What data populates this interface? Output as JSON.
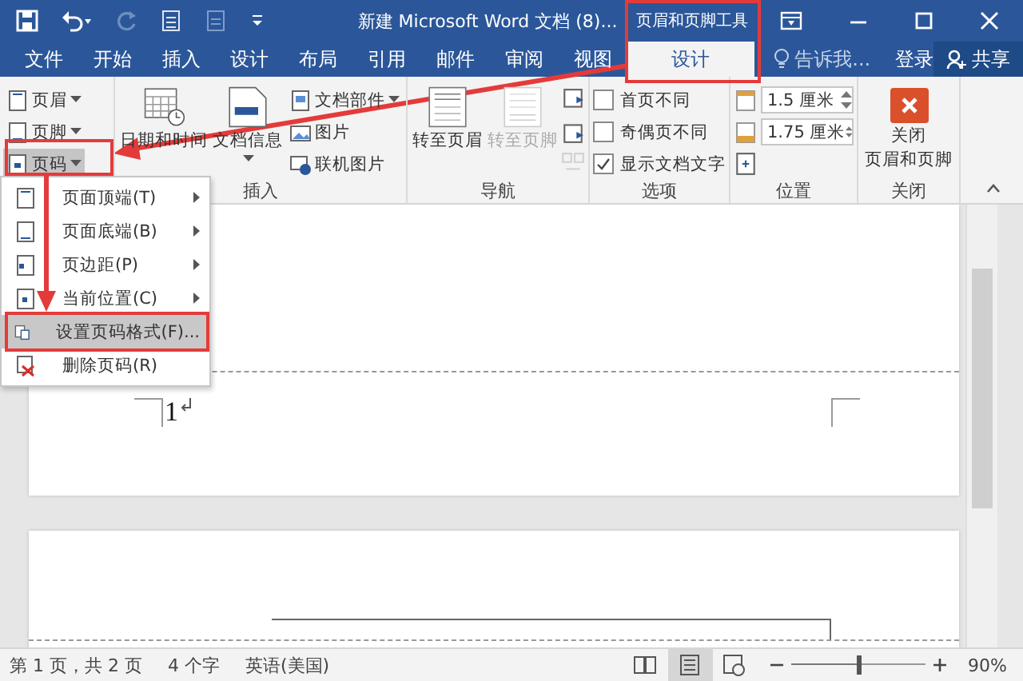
{
  "title_bar": {
    "document_title": "新建 Microsoft Word 文档 (8)...",
    "context_label": "页眉和页脚工具",
    "redo_disabled": true
  },
  "tabs": [
    {
      "label": "文件",
      "selected": false
    },
    {
      "label": "开始",
      "selected": false
    },
    {
      "label": "插入",
      "selected": false
    },
    {
      "label": "设计",
      "selected": false
    },
    {
      "label": "布局",
      "selected": false
    },
    {
      "label": "引用",
      "selected": false
    },
    {
      "label": "邮件",
      "selected": false
    },
    {
      "label": "审阅",
      "selected": false
    },
    {
      "label": "视图",
      "selected": false
    },
    {
      "label": "设计",
      "selected": true
    }
  ],
  "tell_me": {
    "placeholder": "告诉我..."
  },
  "sign_in": "登录",
  "share": "共享",
  "ribbon_groups": [
    {
      "columns": [
        [
          {
            "kind": "small",
            "label": "页眉",
            "dropdown": true,
            "pressed": false
          },
          {
            "kind": "small",
            "label": "页脚",
            "dropdown": true,
            "pressed": false
          },
          {
            "kind": "small",
            "label": "页码",
            "dropdown": true,
            "pressed": true
          }
        ]
      ]
    },
    {
      "label": "插入",
      "columns": [
        [
          {
            "kind": "large",
            "label": "日期和时间",
            "dropdown": false,
            "disabled": false
          }
        ],
        [
          {
            "kind": "large",
            "label": "文档信息",
            "dropdown": true,
            "disabled": false
          }
        ],
        [
          {
            "kind": "small",
            "label": "文档部件",
            "dropdown": true,
            "pressed": false
          },
          {
            "kind": "small",
            "label": "图片",
            "dropdown": false,
            "pressed": false
          },
          {
            "kind": "small",
            "label": "联机图片",
            "dropdown": false,
            "pressed": false
          }
        ]
      ]
    },
    {
      "label": "导航",
      "columns": [
        [
          {
            "kind": "large",
            "label": "转至页眉",
            "dropdown": false,
            "disabled": false
          }
        ],
        [
          {
            "kind": "large",
            "label": "转至页脚",
            "dropdown": false,
            "disabled": true
          }
        ],
        [
          {
            "kind": "icon",
            "disabled": false
          },
          {
            "kind": "icon",
            "disabled": false
          },
          {
            "kind": "icon",
            "disabled": true
          }
        ]
      ]
    },
    {
      "label": "选项",
      "columns": [
        [
          {
            "kind": "checkbox",
            "label": "首页不同",
            "checked": false
          },
          {
            "kind": "checkbox",
            "label": "奇偶页不同",
            "checked": false
          },
          {
            "kind": "checkbox",
            "label": "显示文档文字",
            "checked": true
          }
        ]
      ]
    },
    {
      "label": "位置",
      "columns": [
        [
          {
            "kind": "spin",
            "value": "1.5 厘米"
          },
          {
            "kind": "spin",
            "value": "1.75 厘米"
          },
          {
            "kind": "icon",
            "disabled": false
          }
        ]
      ]
    },
    {
      "label": "关闭",
      "columns": [
        [
          {
            "kind": "close",
            "label_lines": [
              "关闭",
              "页眉和页脚"
            ]
          }
        ]
      ]
    }
  ],
  "page_menu": {
    "items": [
      {
        "label": "页面顶端(T)",
        "submenu": true,
        "selected": false
      },
      {
        "label": "页面底端(B)",
        "submenu": true,
        "selected": false
      },
      {
        "label": "页边距(P)",
        "submenu": true,
        "selected": false
      },
      {
        "label": "当前位置(C)",
        "submenu": true,
        "selected": false
      },
      {
        "label": "设置页码格式(F)...",
        "submenu": false,
        "selected": true
      },
      {
        "label": "删除页码(R)",
        "submenu": false,
        "selected": false
      }
    ]
  },
  "document": {
    "page_number": "1"
  },
  "status_bar": {
    "page_info": "第 1 页，共 2 页",
    "word_count": "4 个字",
    "language": "英语(美国)",
    "views": [
      {
        "selected": false
      },
      {
        "selected": true
      },
      {
        "selected": false
      }
    ],
    "zoom": {
      "level": 0.5
    },
    "zoom_percent": "90%"
  }
}
